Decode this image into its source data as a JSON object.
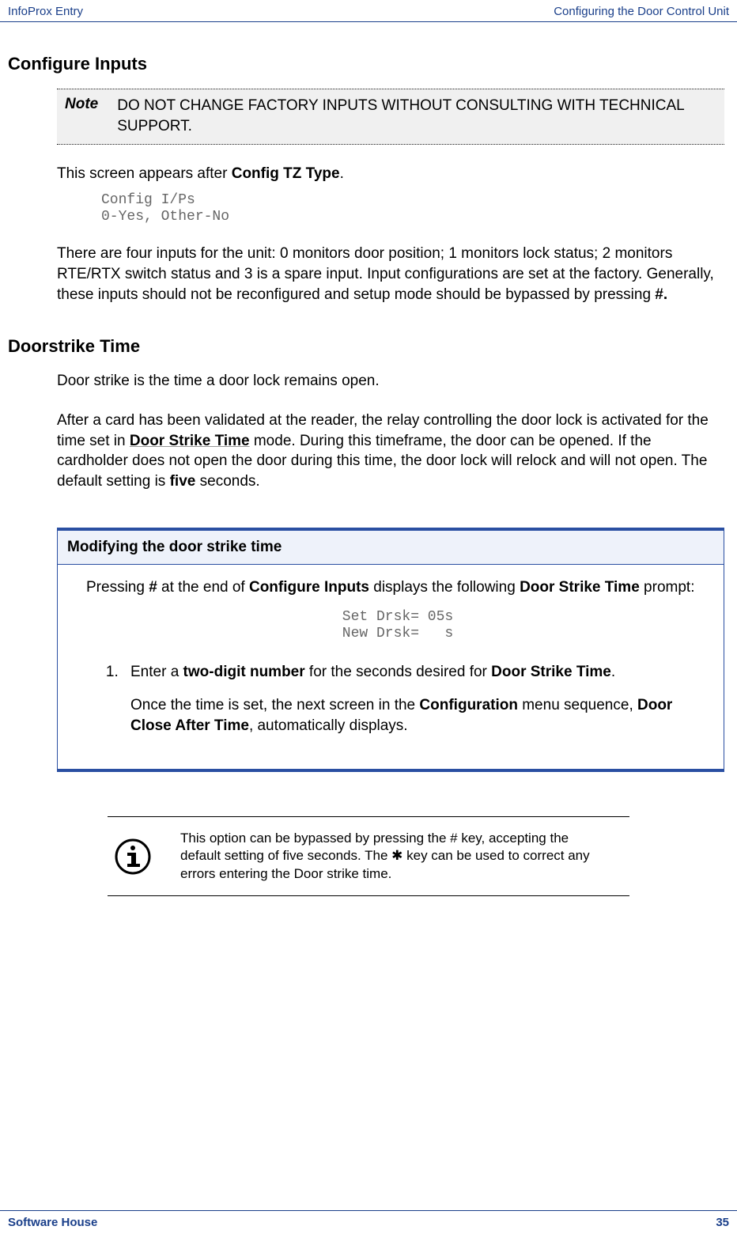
{
  "header": {
    "left": "InfoProx Entry",
    "right": "Configuring the Door Control Unit"
  },
  "sections": {
    "configure_inputs": {
      "title": "Configure Inputs",
      "note_label": "Note",
      "note_text": "DO NOT CHANGE FACTORY INPUTS WITHOUT CONSULTING WITH TECHNICAL SUPPORT.",
      "intro_prefix": "This screen appears after ",
      "intro_bold": "Config TZ Type",
      "intro_suffix": ".",
      "code": "Config I/Ps\n0-Yes, Other-No",
      "body_before_hash": "There are four inputs for the unit: 0 monitors door position; 1 monitors lock status; 2 monitors RTE/RTX switch status and 3 is a spare input. Input configurations are set at the factory. Generally, these inputs should not be reconfigured and setup mode should be bypassed by pressing ",
      "body_hash": "#.",
      "body_after_hash": ""
    },
    "doorstrike": {
      "title": "Doorstrike Time",
      "p1": "Door strike is the time a door lock remains open.",
      "p2_a": "After a card has been validated at the reader, the relay controlling the door lock is activated for the time set in ",
      "p2_b_bold": "Door Strike Time",
      "p2_c": " mode. During this timeframe, the door can be opened. If the cardholder does not open the door during this time, the door lock will relock and will not open. The default setting is ",
      "p2_d_bold": "five",
      "p2_e": " seconds."
    },
    "procedure": {
      "title": "Modifying the door strike time",
      "lead_a": "Pressing ",
      "lead_b_bold": "#",
      "lead_c": " at the end of ",
      "lead_d_bold": "Configure Inputs",
      "lead_e": " displays the following ",
      "lead_f_bold": "Door Strike Time",
      "lead_g": " prompt:",
      "code": "Set Drsk= 05s\nNew Drsk=   s",
      "step1_a": "Enter a ",
      "step1_b_bold": "two-digit number",
      "step1_c": " for the seconds desired for ",
      "step1_d_bold": "Door Strike Time",
      "step1_e": ".",
      "step1_note_a": "Once the time is set, the next screen in the ",
      "step1_note_b_bold": "Configuration",
      "step1_note_c": " menu sequence, ",
      "step1_note_d_bold": "Door Close After Time",
      "step1_note_e": ", automatically displays."
    },
    "info": {
      "text_a": "This option can be bypassed by pressing the # key, accepting the default setting of five seconds. The ",
      "star": "✱",
      "text_b": " key can be used to correct any errors entering the Door strike time."
    }
  },
  "footer": {
    "left": "Software House",
    "right": "35"
  }
}
